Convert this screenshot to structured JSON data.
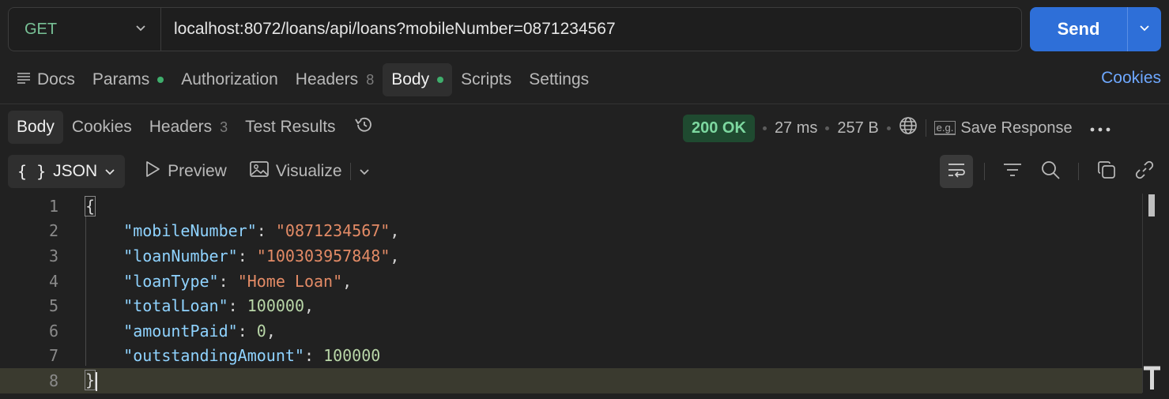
{
  "request": {
    "method": "GET",
    "url": "localhost:8072/loans/api/loans?mobileNumber=0871234567",
    "send_label": "Send"
  },
  "request_tabs": {
    "docs": "Docs",
    "params": "Params",
    "authorization": "Authorization",
    "headers": "Headers",
    "headers_count": "8",
    "body": "Body",
    "scripts": "Scripts",
    "settings": "Settings",
    "cookies": "Cookies"
  },
  "response_tabs": {
    "body": "Body",
    "cookies": "Cookies",
    "headers": "Headers",
    "headers_count": "3",
    "test_results": "Test Results"
  },
  "response_status": {
    "status": "200 OK",
    "time": "27 ms",
    "size": "257 B",
    "save_response": "Save Response",
    "eg_label": "e.g."
  },
  "body_toolbar": {
    "format": "JSON",
    "preview": "Preview",
    "visualize": "Visualize"
  },
  "editor": {
    "line_numbers": [
      "1",
      "2",
      "3",
      "4",
      "5",
      "6",
      "7",
      "8"
    ],
    "lines": [
      {
        "key": "mobileNumber",
        "value": "\"0871234567\"",
        "comma": ","
      },
      {
        "key": "loanNumber",
        "value": "\"100303957848\"",
        "comma": ","
      },
      {
        "key": "loanType",
        "value": "\"Home Loan\"",
        "comma": ","
      },
      {
        "key": "totalLoan",
        "value": "100000",
        "comma": ","
      },
      {
        "key": "amountPaid",
        "value": "0",
        "comma": ","
      },
      {
        "key": "outstandingAmount",
        "value": "100000",
        "comma": ""
      }
    ],
    "open_brace": "{",
    "close_brace": "}"
  },
  "colors": {
    "accent": "#2e6fd8",
    "status_ok_bg": "#1f4a30",
    "status_ok_text": "#7dd8a0",
    "json_key": "#8fd3ff",
    "json_string": "#e38b66",
    "json_number": "#b9d7a8"
  }
}
